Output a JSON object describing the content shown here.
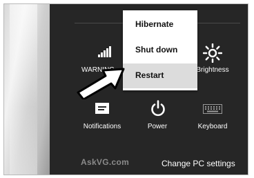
{
  "panel": {
    "network_label": "WARNING",
    "brightness_label": "Brightness",
    "notifications_label": "Notifications",
    "power_label": "Power",
    "keyboard_label": "Keyboard",
    "change_pc_settings": "Change PC settings"
  },
  "power_menu": {
    "items": [
      {
        "label": "Hibernate"
      },
      {
        "label": "Shut down"
      },
      {
        "label": "Restart",
        "highlighted": true
      }
    ]
  },
  "watermark": "AskVG.com",
  "icons": {
    "network": "signal-bars-icon",
    "brightness": "sun-icon",
    "notifications": "message-icon",
    "power": "power-icon",
    "keyboard": "keyboard-icon",
    "pointer": "arrow-pointer-icon"
  },
  "colors": {
    "panel_bg": "#262626",
    "menu_bg": "#ffffff",
    "menu_highlight": "#dcdcdc",
    "watermark": "#8a8a8a"
  }
}
